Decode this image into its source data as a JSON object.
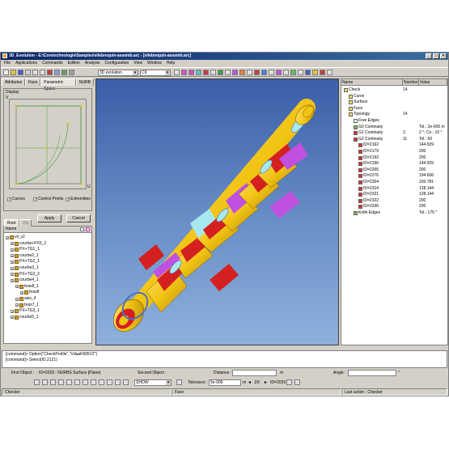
{
  "window": {
    "title": "3D_Evolution - E:\\Coretechnologie\\Samples\\vilebrequin-assemb.arc - [vilebrequin-assemb.arc]",
    "controls": [
      "_",
      "□",
      "×"
    ]
  },
  "menu": [
    "File",
    "Applications",
    "Commands",
    "Edition",
    "Analysis",
    "Configuration",
    "View",
    "Window",
    "Help"
  ],
  "toolbar": {
    "module_combo": "3D evolution",
    "second_combo": "C9"
  },
  "left_panel": {
    "tabs": [
      "Attributes",
      "Face",
      "Parametric Space",
      "NURB"
    ],
    "active_tab": "Parametric Space",
    "display_label": "Display",
    "axis_v": "V",
    "axis_u": "U",
    "checks": [
      {
        "label": "Curves",
        "checked": true
      },
      {
        "label": "Control Points",
        "checked": true
      },
      {
        "label": "Extremities",
        "checked": true
      }
    ],
    "apply_label": "Apply",
    "cancel_label": "Cancel",
    "tree_tabs": [
      "Root",
      "Obj"
    ],
    "tree_header": "Name",
    "tree_items": [
      {
        "label": "vil_v2",
        "depth": 0
      },
      {
        "label": "courbe+PX5_1",
        "depth": 1
      },
      {
        "label": "PX+TG1_1",
        "depth": 1
      },
      {
        "label": "courbe2_1",
        "depth": 1
      },
      {
        "label": "PX+TG2_1",
        "depth": 1
      },
      {
        "label": "courbe3_1",
        "depth": 1
      },
      {
        "label": "PX+TG2_2",
        "depth": 1
      },
      {
        "label": "courbe4_1",
        "depth": 1
      },
      {
        "label": "bras8_1",
        "depth": 2
      },
      {
        "label": "bras8",
        "depth": 3
      },
      {
        "label": "axis_4",
        "depth": 2
      },
      {
        "label": "bras7_1",
        "depth": 2
      },
      {
        "label": "PX+TG3_1",
        "depth": 1
      },
      {
        "label": "courbe5_1",
        "depth": 1
      }
    ]
  },
  "right_panel": {
    "headers": [
      "Name",
      "Number",
      "Value"
    ],
    "rows": [
      {
        "label": "Check",
        "number": "14",
        "value": "",
        "depth": 0,
        "color": "#f0e060"
      },
      {
        "label": "Curve",
        "number": "",
        "value": "",
        "depth": 1,
        "color": "#f0e060"
      },
      {
        "label": "Surface",
        "number": "",
        "value": "",
        "depth": 1,
        "color": "#f0e060"
      },
      {
        "label": "Face",
        "number": "",
        "value": "",
        "depth": 1,
        "color": "#f0e060"
      },
      {
        "label": "Topology",
        "number": "14",
        "value": "",
        "depth": 1,
        "color": "#f0e060"
      },
      {
        "label": "Free Edges",
        "number": "",
        "value": "",
        "depth": 2,
        "color": "#ffffff"
      },
      {
        "label": "G0 Continuity",
        "number": "",
        "value": "Tol.: 2e-005 m",
        "depth": 2,
        "color": "#80c040"
      },
      {
        "label": "G1 Continuity",
        "number": "3",
        "value": "2 °; Co.: 10 °",
        "depth": 2,
        "color": "#e03030"
      },
      {
        "label": "G2 Continuity",
        "number": "11",
        "value": "Tol.: 50",
        "depth": 2,
        "color": "#e03030"
      },
      {
        "label": "ID=2162",
        "number": "",
        "value": "144.929",
        "depth": 3,
        "color": "#e03030"
      },
      {
        "label": "ID=2179",
        "number": "",
        "value": "200",
        "depth": 3,
        "color": "#e03030"
      },
      {
        "label": "ID=2192",
        "number": "",
        "value": "200",
        "depth": 3,
        "color": "#e03030"
      },
      {
        "label": "ID=2196",
        "number": "",
        "value": "144.929",
        "depth": 3,
        "color": "#e03030"
      },
      {
        "label": "ID=2265",
        "number": "",
        "value": "200",
        "depth": 3,
        "color": "#e03030"
      },
      {
        "label": "ID=2276",
        "number": "",
        "value": "194.606",
        "depth": 3,
        "color": "#e03030"
      },
      {
        "label": "ID=2304",
        "number": "",
        "value": "150.781",
        "depth": 3,
        "color": "#e03030"
      },
      {
        "label": "ID=2314",
        "number": "",
        "value": "128.144",
        "depth": 3,
        "color": "#e03030"
      },
      {
        "label": "ID=2321",
        "number": "",
        "value": "128.144",
        "depth": 3,
        "color": "#e03030"
      },
      {
        "label": "ID=2322",
        "number": "",
        "value": "200",
        "depth": 3,
        "color": "#e03030"
      },
      {
        "label": "ID=2330",
        "number": "",
        "value": "200",
        "depth": 3,
        "color": "#e03030"
      },
      {
        "label": "Knife Edges",
        "number": "",
        "value": "Tol.: 175 °",
        "depth": 2,
        "color": "#80c040"
      }
    ]
  },
  "console": {
    "lines": [
      "[command]> Option(\"CheckProfile\",\"Vdaafr905V2\")",
      "[command]> Select(ID,2121)"
    ]
  },
  "object_bar": {
    "first_object_label": "First Object :",
    "first_object_value": "ID=2029 : NURBS Surface [Plane]",
    "second_object_label": "Second Object :",
    "distance_label": "Distance :",
    "distance_unit": "m",
    "angle_label": "Angle :",
    "angle_unit": "°",
    "show_combo": "SHOW",
    "tolerance_label": "Tolerance :",
    "tolerance_value": "5e-006",
    "tolerance_unit": "m",
    "pager": "1/5",
    "current_id": "ID=2029"
  },
  "status": {
    "mode": "Checker",
    "selection": "Face",
    "last_action": "Last action : Checker"
  },
  "colors": {
    "part_yellow": "#f2c414",
    "part_red": "#d42020",
    "part_magenta": "#c050e0",
    "part_cyan": "#a8e8f0",
    "viewport_top": "#3a5ea8",
    "viewport_bottom": "#8fb0dc"
  }
}
